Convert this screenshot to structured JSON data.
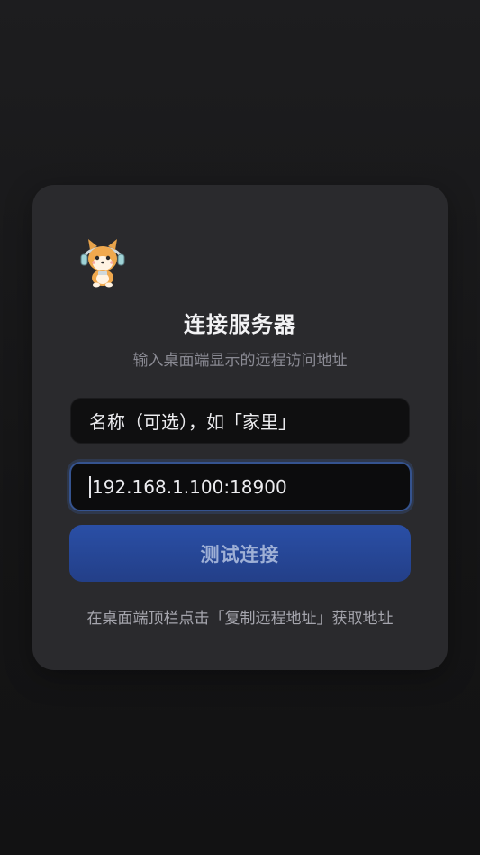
{
  "header": {
    "title": "连接服务器",
    "subtitle": "输入桌面端显示的远程访问地址"
  },
  "form": {
    "name_placeholder": "名称（可选），如「家里」",
    "url_value": "192.168.1.100:18900"
  },
  "actions": {
    "test_label": "测试连接"
  },
  "footer": {
    "hint": "在桌面端顶栏点击「复制远程地址」获取地址"
  },
  "colors": {
    "accent": "#2a4fa6",
    "card": "#2a2a2d",
    "background": "#1d1d1f"
  },
  "icons": {
    "logo": "shiba-dog-headphones-icon"
  }
}
